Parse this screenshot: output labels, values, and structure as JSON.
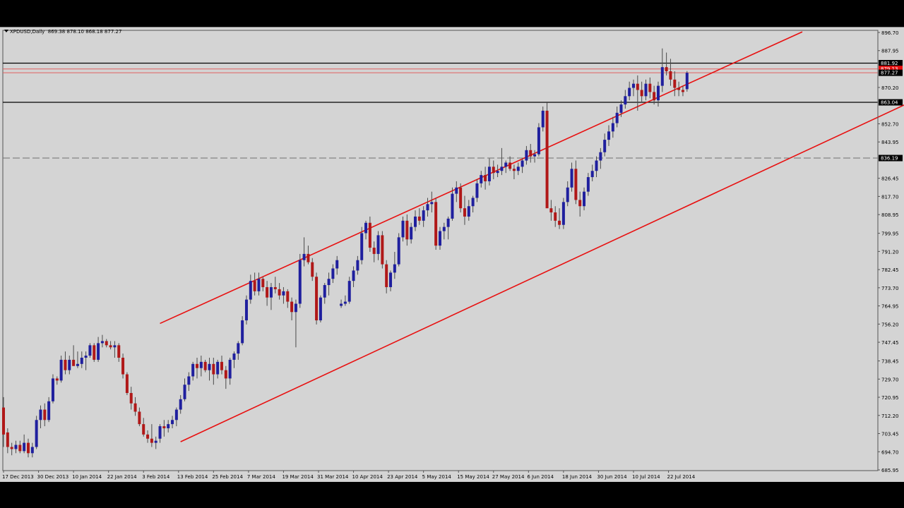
{
  "header": {
    "symbol": "XPDUSD,Daily",
    "ohlc": "869.38 878.10 868.18 877.27"
  },
  "colors": {
    "background": "#d4d4d4",
    "bull_candle": "#1f1f9e",
    "bear_candle": "#b01818",
    "trendline": "#e81010",
    "level_line": "#000000",
    "dashed_line": "#707070"
  },
  "chart_data": {
    "type": "candlestick",
    "title": "",
    "instrument": "XPDUSD",
    "timeframe": "Daily",
    "last_ohlc": {
      "open": 869.38,
      "high": 878.1,
      "low": 868.18,
      "close": 877.27
    },
    "ylim": [
      685.95,
      896.7
    ],
    "y_ticks": [
      896.7,
      887.95,
      870.2,
      852.7,
      843.95,
      826.45,
      817.7,
      808.95,
      799.95,
      791.2,
      782.45,
      773.7,
      764.95,
      756.2,
      747.45,
      738.45,
      729.7,
      720.95,
      712.2,
      703.45,
      694.7,
      685.95
    ],
    "x_ticks": [
      "17 Dec 2013",
      "30 Dec 2013",
      "10 Jan 2014",
      "22 Jan 2014",
      "3 Feb 2014",
      "13 Feb 2014",
      "25 Feb 2014",
      "7 Mar 2014",
      "19 Mar 2014",
      "31 Mar 2014",
      "10 Apr 2014",
      "23 Apr 2014",
      "5 May 2014",
      "15 May 2014",
      "27 May 2014",
      "6 Jun 2014",
      "18 Jun 2014",
      "30 Jun 2014",
      "10 Jul 2014",
      "22 Jul 2014"
    ],
    "price_labels": [
      {
        "value": 881.92,
        "label": "881.92",
        "style": "black"
      },
      {
        "value": 879.13,
        "label": "879.13",
        "style": "red"
      },
      {
        "value": 877.27,
        "label": "877.27",
        "style": "black"
      },
      {
        "value": 863.04,
        "label": "863.04",
        "style": "black"
      },
      {
        "value": 836.19,
        "label": "836.19",
        "style": "black"
      }
    ],
    "horizontal_lines": [
      {
        "value": 881.92,
        "style": "solid",
        "color": "#000000"
      },
      {
        "value": 879.13,
        "style": "solid",
        "color": "#e06060"
      },
      {
        "value": 877.27,
        "style": "solid",
        "color": "#e06060"
      },
      {
        "value": 863.04,
        "style": "solid",
        "color": "#000000"
      },
      {
        "value": 836.19,
        "style": "dashed",
        "color": "#707070"
      }
    ],
    "trendlines": [
      {
        "name": "channel-top",
        "from": {
          "bar": 38,
          "price": 756.5
        },
        "to": {
          "bar": 194,
          "price": 897.0
        }
      },
      {
        "name": "channel-bottom",
        "from": {
          "bar": 43,
          "price": 699.5
        },
        "to": {
          "bar": 219,
          "price": 862.0
        }
      }
    ],
    "candles": [
      [
        0,
        716.0,
        721.0,
        697.0,
        703.0
      ],
      [
        1,
        704.0,
        706.0,
        694.0,
        697.0
      ],
      [
        2,
        697.0,
        699.0,
        693.0,
        696.0
      ],
      [
        3,
        696.0,
        700.0,
        694.0,
        698.0
      ],
      [
        4,
        698.0,
        700.0,
        694.0,
        695.0
      ],
      [
        5,
        695.0,
        703.0,
        694.0,
        699.0
      ],
      [
        6,
        699.0,
        701.0,
        692.0,
        694.0
      ],
      [
        7,
        694.0,
        699.0,
        692.0,
        697.0
      ],
      [
        8,
        697.0,
        712.0,
        696.0,
        710.0
      ],
      [
        9,
        710.0,
        717.0,
        706.0,
        715.0
      ],
      [
        10,
        715.0,
        718.0,
        707.0,
        710.0
      ],
      [
        11,
        710.0,
        721.0,
        709.0,
        719.0
      ],
      [
        12,
        719.0,
        732.0,
        718.0,
        730.0
      ],
      [
        13,
        730.0,
        731.0,
        727.0,
        729.0
      ],
      [
        14,
        729.0,
        741.0,
        728.0,
        739.0
      ],
      [
        15,
        739.0,
        743.0,
        732.0,
        734.0
      ],
      [
        16,
        734.0,
        741.0,
        732.0,
        739.0
      ],
      [
        17,
        739.0,
        746.0,
        736.0,
        736.0
      ],
      [
        18,
        736.0,
        743.0,
        735.0,
        737.0
      ],
      [
        19,
        737.0,
        743.0,
        735.0,
        740.0
      ],
      [
        20,
        740.0,
        743.0,
        734.0,
        741.0
      ],
      [
        21,
        741.0,
        747.0,
        740.0,
        746.0
      ],
      [
        22,
        746.0,
        747.0,
        738.0,
        739.0
      ],
      [
        23,
        739.0,
        750.0,
        738.0,
        747.0
      ],
      [
        24,
        747.0,
        751.0,
        745.0,
        748.0
      ],
      [
        25,
        748.0,
        749.0,
        745.0,
        746.0
      ],
      [
        26,
        746.0,
        748.0,
        744.0,
        745.0
      ],
      [
        27,
        745.0,
        748.0,
        740.0,
        746.0
      ],
      [
        28,
        746.0,
        747.0,
        738.0,
        740.0
      ],
      [
        29,
        740.0,
        742.0,
        730.0,
        732.0
      ],
      [
        30,
        732.0,
        733.0,
        722.0,
        723.0
      ],
      [
        31,
        723.0,
        726.0,
        715.0,
        718.0
      ],
      [
        32,
        718.0,
        721.0,
        712.0,
        714.0
      ],
      [
        33,
        714.0,
        716.0,
        707.0,
        708.0
      ],
      [
        34,
        708.0,
        711.0,
        702.0,
        703.0
      ],
      [
        35,
        703.0,
        705.0,
        699.0,
        701.0
      ],
      [
        36,
        701.0,
        708.0,
        697.0,
        699.0
      ],
      [
        37,
        699.0,
        702.0,
        696.0,
        700.0
      ],
      [
        38,
        701.0,
        708.0,
        699.0,
        707.0
      ],
      [
        39,
        707.0,
        710.0,
        702.0,
        706.0
      ],
      [
        40,
        706.0,
        710.0,
        704.0,
        708.0
      ],
      [
        41,
        708.0,
        712.0,
        706.0,
        710.0
      ],
      [
        42,
        710.0,
        716.0,
        707.0,
        715.0
      ],
      [
        43,
        715.0,
        722.0,
        713.0,
        720.0
      ],
      [
        44,
        720.0,
        730.0,
        719.0,
        727.0
      ],
      [
        45,
        727.0,
        733.0,
        724.0,
        731.0
      ],
      [
        46,
        731.0,
        738.0,
        729.0,
        737.0
      ],
      [
        47,
        737.0,
        740.0,
        730.0,
        735.0
      ],
      [
        48,
        735.0,
        741.0,
        731.0,
        738.0
      ],
      [
        49,
        738.0,
        739.0,
        733.0,
        734.0
      ],
      [
        50,
        734.0,
        740.0,
        729.0,
        737.0
      ],
      [
        51,
        737.0,
        740.0,
        727.0,
        732.0
      ],
      [
        52,
        732.0,
        739.0,
        730.0,
        738.0
      ],
      [
        53,
        738.0,
        741.0,
        732.0,
        734.0
      ],
      [
        54,
        734.0,
        736.0,
        725.0,
        730.0
      ],
      [
        55,
        730.0,
        740.0,
        727.0,
        739.0
      ],
      [
        56,
        739.0,
        743.0,
        735.0,
        742.0
      ],
      [
        57,
        742.0,
        748.0,
        739.0,
        747.0
      ],
      [
        58,
        747.0,
        760.0,
        746.0,
        758.0
      ],
      [
        59,
        758.0,
        770.0,
        756.0,
        768.0
      ],
      [
        60,
        768.0,
        780.0,
        766.0,
        777.0
      ],
      [
        61,
        777.0,
        781.0,
        770.0,
        772.0
      ],
      [
        62,
        772.0,
        781.0,
        770.0,
        778.0
      ],
      [
        63,
        778.0,
        779.0,
        772.0,
        774.0
      ],
      [
        64,
        774.0,
        777.0,
        765.0,
        769.0
      ],
      [
        65,
        769.0,
        776.0,
        763.0,
        774.0
      ],
      [
        66,
        774.0,
        779.0,
        771.0,
        773.0
      ],
      [
        67,
        773.0,
        776.0,
        768.0,
        770.0
      ],
      [
        68,
        770.0,
        774.0,
        766.0,
        772.0
      ],
      [
        69,
        772.0,
        773.0,
        764.0,
        767.0
      ],
      [
        70,
        767.0,
        769.0,
        758.0,
        762.0
      ],
      [
        71,
        762.0,
        768.0,
        745.0,
        766.0
      ],
      [
        72,
        766.0,
        790.0,
        764.0,
        787.0
      ],
      [
        73,
        787.0,
        798.0,
        784.0,
        790.0
      ],
      [
        74,
        790.0,
        794.0,
        785.0,
        786.0
      ],
      [
        75,
        786.0,
        788.0,
        777.0,
        779.0
      ],
      [
        76,
        779.0,
        781.0,
        756.0,
        758.0
      ],
      [
        77,
        758.0,
        770.0,
        757.0,
        769.0
      ],
      [
        78,
        769.0,
        776.0,
        766.0,
        775.0
      ],
      [
        79,
        775.0,
        781.0,
        770.0,
        778.0
      ],
      [
        80,
        778.0,
        785.0,
        776.0,
        783.0
      ],
      [
        81,
        783.0,
        789.0,
        780.0,
        787.0
      ],
      [
        82,
        765.0,
        768.0,
        764.0,
        766.0
      ],
      [
        83,
        766.0,
        770.0,
        765.0,
        767.0
      ],
      [
        84,
        767.0,
        779.0,
        766.0,
        777.0
      ],
      [
        85,
        777.0,
        784.0,
        774.0,
        782.0
      ],
      [
        86,
        782.0,
        789.0,
        780.0,
        787.0
      ],
      [
        87,
        787.0,
        803.0,
        785.0,
        800.0
      ],
      [
        88,
        800.0,
        806.0,
        797.0,
        805.0
      ],
      [
        89,
        805.0,
        808.0,
        791.0,
        793.0
      ],
      [
        90,
        793.0,
        796.0,
        786.0,
        790.0
      ],
      [
        91,
        790.0,
        801.0,
        787.0,
        799.0
      ],
      [
        92,
        799.0,
        801.0,
        783.0,
        785.0
      ],
      [
        93,
        785.0,
        787.0,
        771.0,
        774.0
      ],
      [
        94,
        774.0,
        782.0,
        772.0,
        781.0
      ],
      [
        95,
        781.0,
        791.0,
        778.0,
        785.0
      ],
      [
        96,
        785.0,
        800.0,
        784.0,
        798.0
      ],
      [
        97,
        798.0,
        808.0,
        796.0,
        806.0
      ],
      [
        98,
        806.0,
        809.0,
        794.0,
        797.0
      ],
      [
        99,
        797.0,
        805.0,
        795.0,
        803.0
      ],
      [
        100,
        803.0,
        811.0,
        801.0,
        808.0
      ],
      [
        101,
        808.0,
        812.0,
        804.0,
        806.0
      ],
      [
        102,
        806.0,
        813.0,
        803.0,
        811.0
      ],
      [
        103,
        811.0,
        817.0,
        808.0,
        814.0
      ],
      [
        104,
        814.0,
        820.0,
        810.0,
        815.0
      ],
      [
        105,
        815.0,
        817.0,
        792.0,
        794.0
      ],
      [
        106,
        794.0,
        803.0,
        792.0,
        801.0
      ],
      [
        107,
        801.0,
        805.0,
        797.0,
        803.0
      ],
      [
        108,
        803.0,
        808.0,
        797.0,
        807.0
      ],
      [
        109,
        807.0,
        822.0,
        806.0,
        819.0
      ],
      [
        110,
        819.0,
        825.0,
        815.0,
        822.0
      ],
      [
        111,
        822.0,
        824.0,
        810.0,
        812.0
      ],
      [
        112,
        812.0,
        818.0,
        804.0,
        808.0
      ],
      [
        113,
        808.0,
        816.0,
        806.0,
        813.0
      ],
      [
        114,
        813.0,
        818.0,
        810.0,
        817.0
      ],
      [
        115,
        817.0,
        826.0,
        815.0,
        824.0
      ],
      [
        116,
        824.0,
        830.0,
        822.0,
        828.0
      ],
      [
        117,
        828.0,
        832.0,
        821.0,
        825.0
      ],
      [
        118,
        825.0,
        836.0,
        823.0,
        832.0
      ],
      [
        119,
        832.0,
        835.0,
        826.0,
        829.0
      ],
      [
        120,
        829.0,
        833.0,
        827.0,
        830.0
      ],
      [
        121,
        830.0,
        841.0,
        828.0,
        832.0
      ],
      [
        122,
        832.0,
        835.0,
        829.0,
        834.0
      ],
      [
        123,
        834.0,
        837.0,
        830.0,
        831.0
      ],
      [
        124,
        831.0,
        833.0,
        826.0,
        830.0
      ],
      [
        125,
        830.0,
        834.0,
        828.0,
        832.0
      ],
      [
        126,
        832.0,
        836.0,
        829.0,
        835.0
      ],
      [
        127,
        835.0,
        842.0,
        833.0,
        840.0
      ],
      [
        128,
        840.0,
        843.0,
        834.0,
        837.0
      ],
      [
        129,
        837.0,
        840.0,
        834.0,
        838.0
      ],
      [
        130,
        838.0,
        853.0,
        837.0,
        851.0
      ],
      [
        131,
        851.0,
        861.0,
        849.0,
        859.0
      ],
      [
        132,
        859.0,
        863.0,
        853.0,
        812.0
      ],
      [
        133,
        812.0,
        816.0,
        806.0,
        810.0
      ],
      [
        134,
        810.0,
        813.0,
        803.0,
        806.0
      ],
      [
        135,
        806.0,
        812.0,
        802.0,
        804.0
      ],
      [
        136,
        804.0,
        817.0,
        802.0,
        815.0
      ],
      [
        137,
        815.0,
        825.0,
        813.0,
        822.0
      ],
      [
        138,
        822.0,
        834.0,
        820.0,
        831.0
      ],
      [
        139,
        831.0,
        835.0,
        814.0,
        816.0
      ],
      [
        140,
        816.0,
        820.0,
        808.0,
        813.0
      ],
      [
        141,
        813.0,
        822.0,
        811.0,
        820.0
      ],
      [
        142,
        820.0,
        829.0,
        818.0,
        827.0
      ],
      [
        143,
        827.0,
        833.0,
        825.0,
        830.0
      ],
      [
        144,
        830.0,
        837.0,
        827.0,
        835.0
      ],
      [
        145,
        835.0,
        841.0,
        831.0,
        839.0
      ],
      [
        146,
        839.0,
        848.0,
        837.0,
        845.0
      ],
      [
        147,
        845.0,
        852.0,
        842.0,
        849.0
      ],
      [
        148,
        849.0,
        856.0,
        846.0,
        853.0
      ],
      [
        149,
        853.0,
        861.0,
        851.0,
        858.0
      ],
      [
        150,
        858.0,
        864.0,
        856.0,
        862.0
      ],
      [
        151,
        862.0,
        869.0,
        860.0,
        866.0
      ],
      [
        152,
        866.0,
        873.0,
        864.0,
        870.0
      ],
      [
        153,
        870.0,
        874.0,
        866.0,
        872.0
      ],
      [
        154,
        872.0,
        876.0,
        859.0,
        869.0
      ],
      [
        155,
        869.0,
        873.0,
        863.0,
        866.0
      ],
      [
        156,
        866.0,
        874.0,
        864.0,
        872.0
      ],
      [
        157,
        872.0,
        875.0,
        865.0,
        868.0
      ],
      [
        158,
        868.0,
        871.0,
        862.0,
        864.0
      ],
      [
        159,
        864.0,
        873.0,
        861.0,
        871.0
      ],
      [
        160,
        871.0,
        889.0,
        868.0,
        880.0
      ],
      [
        161,
        880.0,
        887.0,
        876.0,
        878.0
      ],
      [
        162,
        878.0,
        884.0,
        871.0,
        874.0
      ],
      [
        163,
        874.0,
        878.0,
        866.0,
        870.0
      ],
      [
        164,
        870.0,
        873.0,
        866.0,
        869.0
      ],
      [
        165,
        869.0,
        871.0,
        866.0,
        868.0
      ],
      [
        166,
        869.38,
        878.1,
        868.18,
        877.27
      ]
    ]
  }
}
